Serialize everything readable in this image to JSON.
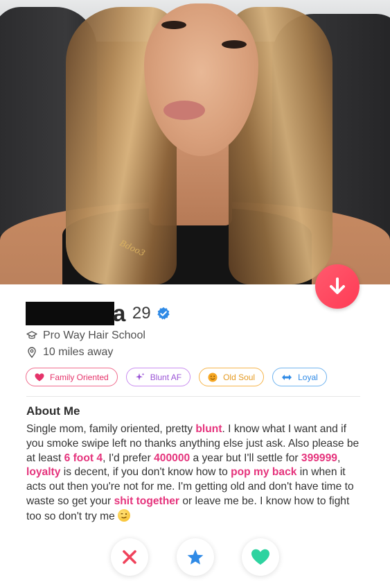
{
  "profile": {
    "name_visible_suffix": "a",
    "age": "29",
    "school": "Pro Way Hair School",
    "distance": "10 miles away",
    "verified": true,
    "photo_necklace": "Bdoo3"
  },
  "tags": [
    {
      "label": "Family Oriented",
      "icon": "heart-icon",
      "color": "#e5336a"
    },
    {
      "label": "Blunt AF",
      "icon": "sparkle-icon",
      "color": "#9b55d6"
    },
    {
      "label": "Old Soul",
      "icon": "smiley-icon",
      "color": "#e59a22"
    },
    {
      "label": "Loyal",
      "icon": "arrows-icon",
      "color": "#2f8ae6"
    }
  ],
  "about": {
    "title": "About Me",
    "segments": [
      {
        "text": "Single mom, family oriented, pretty ",
        "hl": false
      },
      {
        "text": "blunt",
        "hl": true
      },
      {
        "text": ". I know what I want and if you smoke swipe left no thanks anything else just ask. Also please be at least ",
        "hl": false
      },
      {
        "text": "6 foot 4",
        "hl": true
      },
      {
        "text": ", I'd prefer ",
        "hl": false
      },
      {
        "text": "400000",
        "hl": true
      },
      {
        "text": " a year but I'll settle for ",
        "hl": false
      },
      {
        "text": "399999",
        "hl": true
      },
      {
        "text": ", ",
        "hl": false
      },
      {
        "text": "loyalty",
        "hl": true
      },
      {
        "text": " is decent, if you don't know how to ",
        "hl": false
      },
      {
        "text": "pop my back",
        "hl": true
      },
      {
        "text": " in when it acts out then you're not for me. I'm getting old and don't have time to waste so get your ",
        "hl": false
      },
      {
        "text": "shit together",
        "hl": true
      },
      {
        "text": " or leave me be. I know how to fight too so don't try me",
        "hl": false
      }
    ]
  },
  "actions": {
    "nope_icon": "x-icon",
    "super_like_icon": "star-icon",
    "like_icon": "heart-icon"
  },
  "colors": {
    "accent_pink": "#e5337c",
    "down_button": "#ff4560",
    "nope": "#f0435c",
    "super_like": "#2f8ae6",
    "like": "#2ed3a0"
  }
}
